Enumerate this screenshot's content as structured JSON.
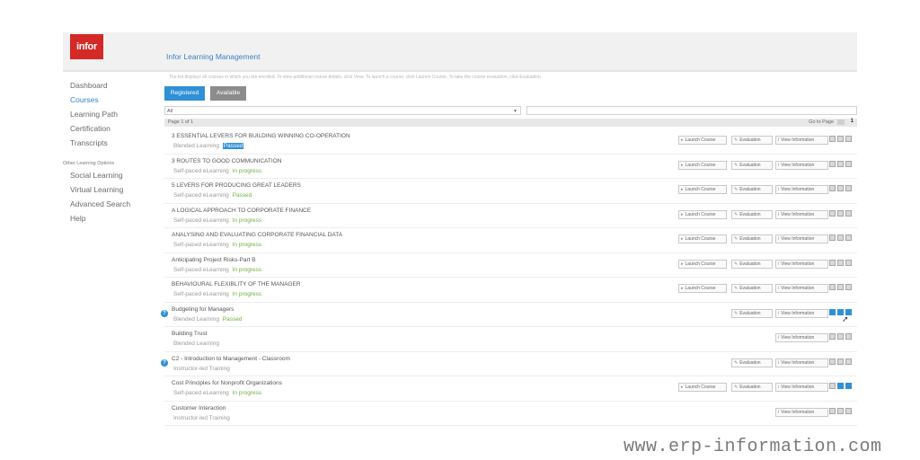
{
  "app": {
    "logo_text": "infor",
    "title": "Infor Learning Management"
  },
  "intro_text": "The list displays all courses in which you are enrolled. To view additional course details, click View. To launch a course, click Launch Course. To take the course evaluation, click Evaluation.",
  "sidebar": {
    "items": [
      {
        "label": "Dashboard",
        "active": false
      },
      {
        "label": "Courses",
        "active": true
      },
      {
        "label": "Learning Path",
        "active": false
      },
      {
        "label": "Certification",
        "active": false
      },
      {
        "label": "Transcripts",
        "active": false
      }
    ],
    "section_title": "Other Learning Options",
    "other_items": [
      {
        "label": "Social Learning"
      },
      {
        "label": "Virtual Learning"
      },
      {
        "label": "Advanced Search"
      },
      {
        "label": "Help"
      }
    ]
  },
  "tabs": {
    "registered": "Registered",
    "available": "Available"
  },
  "filter": {
    "value": "All"
  },
  "pager": {
    "text": "Page 1 of 1",
    "goto_label": "Go to Page",
    "page_number": "1"
  },
  "buttons": {
    "launch": "Launch Course",
    "evaluation": "Evaluation",
    "view": "View Information"
  },
  "courses": [
    {
      "title": "3 ESSENTIAL LEVERS FOR BUILDING WINNING CO-OPERATION",
      "type": "Blended Learning",
      "status": "Passed",
      "highlight": true
    },
    {
      "title": "3 ROUTES TO GOOD COMMUNICATION",
      "type": "Self-paced eLearning",
      "status": "In progress"
    },
    {
      "title": "5 LEVERS FOR PRODUCING GREAT LEADERS",
      "type": "Self-paced eLearning",
      "status": "Passed"
    },
    {
      "title": "A LOGICAL APPROACH TO CORPORATE FINANCE",
      "type": "Self-paced eLearning",
      "status": "In progress"
    },
    {
      "title": "ANALYSING AND EVALUATING CORPORATE FINANCIAL DATA",
      "type": "Self-paced eLearning",
      "status": "In progress"
    },
    {
      "title": "Anticipating Project Risks-Part B",
      "type": "Self-paced eLearning",
      "status": "In progress"
    },
    {
      "title": "BEHAVIOURAL FLEXIBLITY OF THE MANAGER",
      "type": "Self-paced eLearning",
      "status": "In progress"
    },
    {
      "title": "Budgeting for Managers",
      "type": "Blended Learning",
      "status": "Passed",
      "info": true
    },
    {
      "title": "Building Trust",
      "type": "Blended Learning",
      "status": ""
    },
    {
      "title": "C2 - Introduction to Management - Classroom",
      "type": "Instructor-led Training",
      "status": "",
      "info": true
    },
    {
      "title": "Cost Principles for Nonprofit Organizations",
      "type": "Self-paced eLearning",
      "status": "In progress"
    },
    {
      "title": "Customer Interaction",
      "type": "Instructor-led Training",
      "status": ""
    }
  ],
  "watermark": "www.erp-information.com",
  "colors": {
    "accent": "#2f90d6",
    "brand": "#d42a27",
    "status_green": "#6db33f",
    "tab_inactive": "#8c8c8c"
  }
}
